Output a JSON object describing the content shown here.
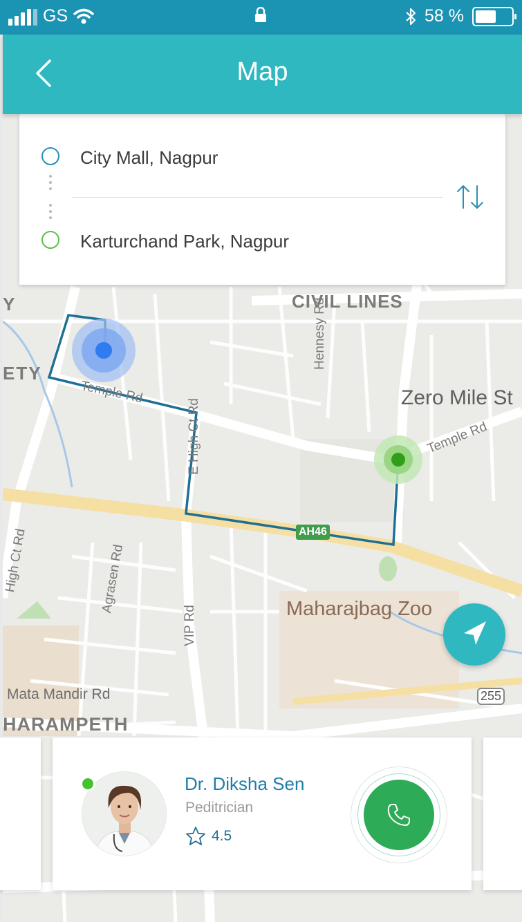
{
  "status_bar": {
    "carrier": "GS",
    "battery_percent_text": "58 %",
    "battery_level": 0.58
  },
  "header": {
    "title": "Map"
  },
  "route": {
    "origin": "City Mall, Nagpur",
    "destination": "Karturchand Park, Nagpur"
  },
  "map": {
    "labels": {
      "civil_lines": "CIVIL LINES",
      "zero_mile": "Zero Mile St",
      "zoo": "Maharajbag Zoo",
      "mata_mandir": "Mata Mandir Rd",
      "dharampeth": "HARAMPETH",
      "ety": "ETY",
      "y": "Y",
      "temple_rd_1": "Temple Rd",
      "temple_rd_2": "Temple Rd",
      "hennesy": "Hennesy Rd",
      "e_high_ct": "E High Ct Rd",
      "agrasen": "Agrasen Rd",
      "vip": "VIP Rd",
      "high_ct": "High Ct Rd",
      "ah": "AH46",
      "route_255": "255"
    }
  },
  "doctor": {
    "name": "Dr. Diksha Sen",
    "role": "Peditrician",
    "rating": "4.5"
  },
  "colors": {
    "status_bar": "#1b93b2",
    "header": "#2fb8c0",
    "route_line": "#1f6f95",
    "call_button": "#2eab57",
    "origin_marker": "#2a8fb2",
    "destination_marker": "#5cc04a"
  }
}
